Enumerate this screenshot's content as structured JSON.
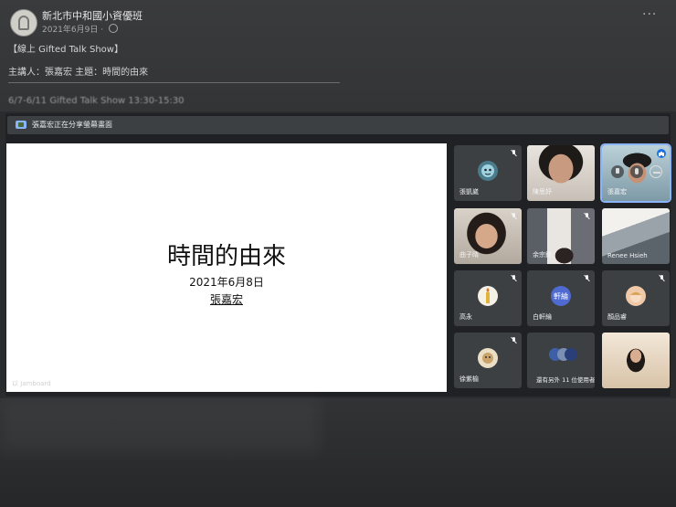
{
  "post": {
    "page_name": "新北市中和國小資優班",
    "date": "2021年6月9日",
    "line1": "【線上 Gifted Talk Show】",
    "line2": "主講人：張嘉宏 主題：時間的由來",
    "line3": "6/7-6/11 Gifted Talk Show 13:30-15:30"
  },
  "meet": {
    "share_text": "張嘉宏正在分享螢幕畫面",
    "slide": {
      "title": "時間的由來",
      "date": "2021年6月8日",
      "presenter": "張嘉宏",
      "footer": "以 Jamboard"
    },
    "participants": [
      {
        "name": "張凱崴",
        "initial": "",
        "muted": true
      },
      {
        "name": "陳思妤",
        "initial": "",
        "muted": false
      },
      {
        "name": "張嘉宏",
        "initial": "",
        "muted": false,
        "speaking": true
      },
      {
        "name": "曲子晴",
        "initial": "",
        "muted": true
      },
      {
        "name": "余宗錡",
        "initial": "",
        "muted": true
      },
      {
        "name": "Renee Hsieh",
        "initial": "",
        "muted": false
      },
      {
        "name": "高永",
        "initial": "",
        "muted": true
      },
      {
        "name": "白軒綸",
        "initial": "軒綸",
        "muted": true
      },
      {
        "name": "顏品睿",
        "initial": "",
        "muted": true
      },
      {
        "name": "徐紫榆",
        "initial": "",
        "muted": true
      },
      {
        "name": "還有另外 11 位使用者",
        "initial": "",
        "muted": false
      },
      {
        "name": "",
        "initial": "",
        "muted": false
      }
    ]
  },
  "colors": {
    "accent": "#8ab4f8",
    "tile_bg": "#3c4043",
    "meet_bg": "#202124"
  }
}
